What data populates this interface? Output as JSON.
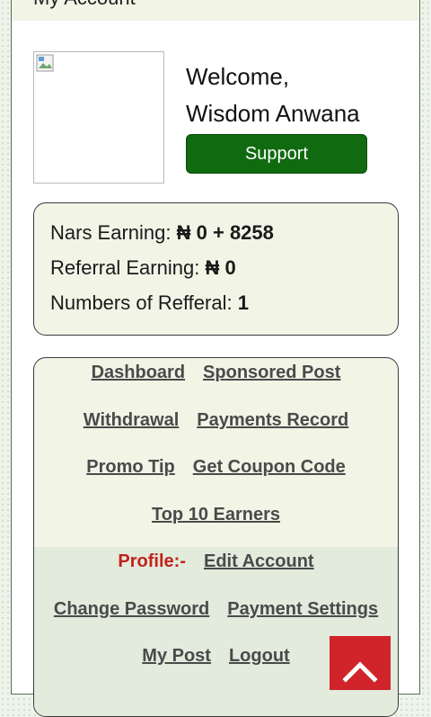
{
  "header": {
    "title": "My Account"
  },
  "profile": {
    "welcome": "Welcome,",
    "name": "Wisdom Anwana",
    "support_label": "Support"
  },
  "earnings": {
    "nars_label": "Nars Earning:",
    "nars_value": "₦ 0 + 8258",
    "referral_label": "Referral Earning:",
    "referral_value": "₦ 0",
    "refcount_label": "Numbers of Refferal:",
    "refcount_value": "1"
  },
  "nav": {
    "dashboard": "Dashboard",
    "sponsored_post": "Sponsored Post",
    "withdrawal": "Withdrawal",
    "payments_record": "Payments Record",
    "promo_tip": "Promo Tip",
    "get_coupon_code": "Get Coupon Code",
    "top_earners": "Top 10 Earners",
    "profile_label": "Profile:-",
    "edit_account": "Edit Account",
    "change_password": "Change Password",
    "payment_settings": "Payment Settings",
    "my_post": "My Post",
    "logout": "Logout"
  },
  "colors": {
    "support_green": "#106a10",
    "profile_red": "#c0221b",
    "scroll_top_red": "#d0242a"
  },
  "icons": {
    "scroll_top": "chevron-up-icon",
    "avatar": "broken-image-icon"
  }
}
